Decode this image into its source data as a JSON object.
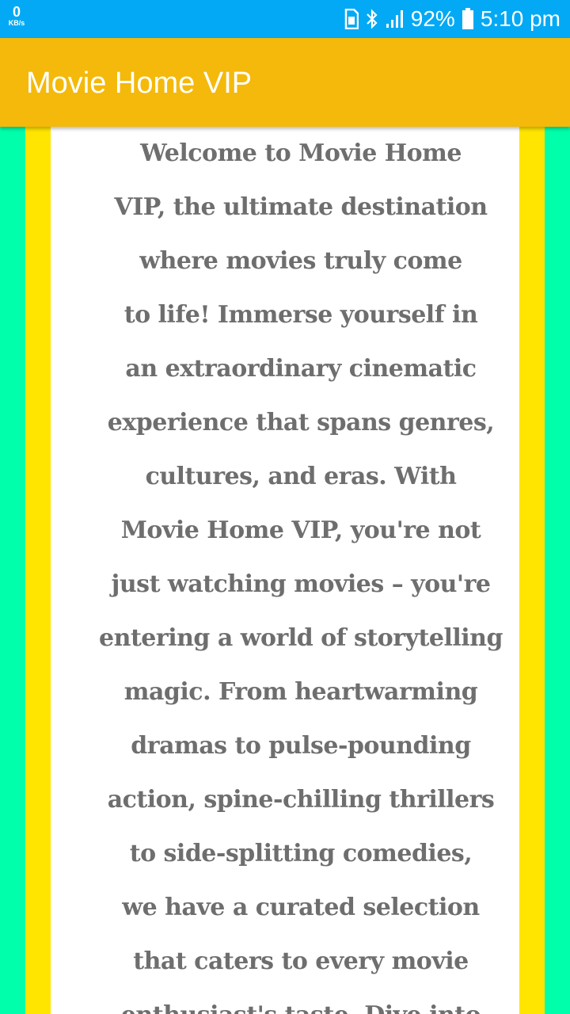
{
  "status_bar": {
    "net_speed_value": "0",
    "net_speed_unit": "KB/s",
    "battery_percent": "92%",
    "time": "5:10 pm",
    "icons": [
      "sim-icon",
      "bluetooth-icon",
      "signal-icon",
      "battery-icon"
    ]
  },
  "app_bar": {
    "title": "Movie Home VIP"
  },
  "content": {
    "lines": [
      "Welcome to Movie Home",
      "VIP, the ultimate destination",
      "where movies truly come",
      "to life! Immerse yourself in",
      "an extraordinary cinematic",
      "experience that spans genres,",
      "cultures, and eras. With",
      "Movie Home VIP, you're not",
      "just watching movies – you're",
      "entering a world of storytelling",
      "magic. From heartwarming",
      "dramas to pulse-pounding",
      "action, spine-chilling thrillers",
      "to side-splitting comedies,",
      "we have a curated selection",
      "that caters to every movie",
      "enthusiast's taste. Dive into"
    ]
  },
  "colors": {
    "status_bar": "#03A9F4",
    "app_bar": "#F4B90B",
    "outer_border": "#00FFAA",
    "inner_border": "#FFE500",
    "card": "#FFFFFF",
    "text": "#6E6E6E"
  }
}
